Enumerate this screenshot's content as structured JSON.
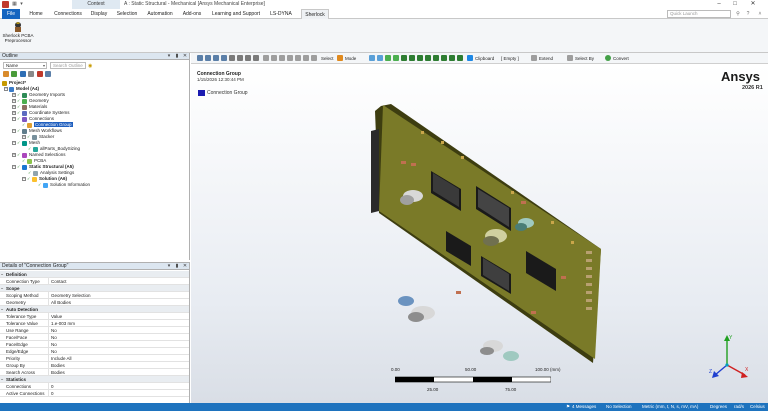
{
  "titlebar": {
    "context_tab": "Context",
    "title": "A : Static Structural - Mechanical [Ansys Mechanical Enterprise]",
    "minimize": "–",
    "maximize": "□",
    "close": "✕"
  },
  "ribbon_tabs": [
    {
      "label": "File"
    },
    {
      "label": "Home"
    },
    {
      "label": "Connections"
    },
    {
      "label": "Display"
    },
    {
      "label": "Selection"
    },
    {
      "label": "Automation"
    },
    {
      "label": "Add-ons"
    },
    {
      "label": "Learning and Support"
    },
    {
      "label": "LS-DYNA Pre"
    },
    {
      "label": "Sherlock"
    }
  ],
  "ribbon_search_placeholder": "Quick Launch",
  "ribbon": {
    "sherlock_button_line1": "Sherlock PCBA",
    "sherlock_button_line2": "Preprocessor"
  },
  "outline": {
    "header": "Outline",
    "filter_value": "Name",
    "search_placeholder": "Search Outline",
    "tree": [
      {
        "label": "Project*",
        "depth": 0,
        "bold": true
      },
      {
        "label": "Model (A4)",
        "depth": 1,
        "bold": true
      },
      {
        "label": "Geometry Imports",
        "depth": 2
      },
      {
        "label": "Geometry",
        "depth": 2
      },
      {
        "label": "Materials",
        "depth": 2
      },
      {
        "label": "Coordinate Systems",
        "depth": 2
      },
      {
        "label": "Connections",
        "depth": 2
      },
      {
        "label": "Connection Group",
        "depth": 3,
        "selected": true
      },
      {
        "label": "Mesh Workflows",
        "depth": 2
      },
      {
        "label": "Stacker",
        "depth": 3
      },
      {
        "label": "Mesh",
        "depth": 2
      },
      {
        "label": "allParts_BodySizing",
        "depth": 3
      },
      {
        "label": "Named Selections",
        "depth": 2
      },
      {
        "label": "PCBA",
        "depth": 2
      },
      {
        "label": "Static Structural (A5)",
        "depth": 2,
        "bold": true
      },
      {
        "label": "Analysis Settings",
        "depth": 3
      },
      {
        "label": "Solution (A6)",
        "depth": 3,
        "bold": true
      },
      {
        "label": "Solution Information",
        "depth": 4
      }
    ]
  },
  "details": {
    "header": "Details of \"Connection Group\"",
    "rows": [
      {
        "section": "Definition"
      },
      {
        "k": "Connection Type",
        "v": "Contact"
      },
      {
        "section": "Scope"
      },
      {
        "k": "Scoping Method",
        "v": "Geometry Selection"
      },
      {
        "k": "Geometry",
        "v": "All Bodies"
      },
      {
        "section": "Auto Detection"
      },
      {
        "k": "Tolerance Type",
        "v": "Value"
      },
      {
        "k": "Tolerance Value",
        "v": "1.e-003 mm"
      },
      {
        "k": "Use Range",
        "v": "No"
      },
      {
        "k": "Face/Face",
        "v": "No"
      },
      {
        "k": "Face/Edge",
        "v": "No"
      },
      {
        "k": "Edge/Edge",
        "v": "No"
      },
      {
        "k": "Priority",
        "v": "Include All"
      },
      {
        "k": "Group By",
        "v": "Bodies"
      },
      {
        "k": "Search Across",
        "v": "Bodies"
      },
      {
        "section": "Statistics"
      },
      {
        "k": "Connections",
        "v": "0"
      },
      {
        "k": "Active Connections",
        "v": "0"
      }
    ]
  },
  "viewport": {
    "toolbar": {
      "select": "Select",
      "mode": "Mode",
      "clipboard": "Clipboard",
      "empty": "[ Empty ]",
      "extend": "Extend",
      "select_by": "Select By",
      "convert": "Convert"
    },
    "title": "Connection Group",
    "date": "1/15/2026 12:30:44 PM",
    "legend": "Connection Group",
    "legend_color": "#1a1ab0",
    "brand": "Ansys",
    "version": "2026 R1",
    "scale": {
      "ticks_top": [
        "0.00",
        "50.00",
        "100.00 (mm)"
      ],
      "ticks_bottom": [
        "25.00",
        "75.00"
      ]
    },
    "triad": {
      "x": "X",
      "y": "Y",
      "z": "Z"
    }
  },
  "statusbar": {
    "messages": "4 Messages",
    "selection": "No Selection",
    "units": "Metric (mm, t, N, s, mV, mA)",
    "angle": "Degrees",
    "rate": "rad/s",
    "temp": "Celsius"
  },
  "colors": {
    "accent": "#1565c0",
    "status_bar": "#1e73be",
    "selection": "#1f5fbf",
    "pcb": "#7a7a28"
  }
}
